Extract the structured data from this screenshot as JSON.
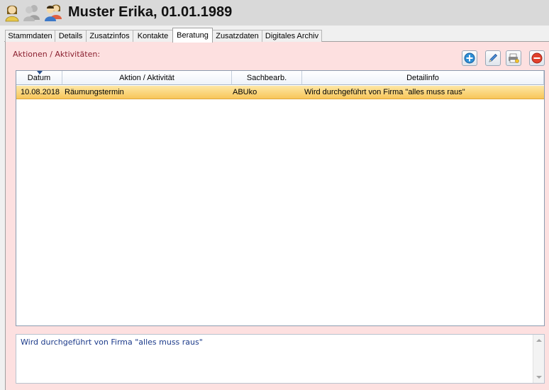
{
  "header": {
    "title": "Muster Erika, 01.01.1989",
    "icons": [
      "person-female-icon",
      "persons-gray-icon",
      "persons-color-icon"
    ]
  },
  "tabs": [
    {
      "label": "Stammdaten",
      "active": false
    },
    {
      "label": "Details",
      "active": false
    },
    {
      "label": "Zusatzinfos",
      "active": false
    },
    {
      "label": "Kontakte",
      "active": false
    },
    {
      "label": "Beratung",
      "active": true
    },
    {
      "label": "Zusatzdaten",
      "active": false
    },
    {
      "label": "Digitales Archiv",
      "active": false
    }
  ],
  "section": {
    "label": "Aktionen / Aktivitäten:"
  },
  "toolbar": {
    "buttons": [
      "add-icon",
      "edit-icon",
      "print-icon",
      "delete-icon"
    ]
  },
  "grid": {
    "columns": [
      "Datum",
      "Aktion / Aktivität",
      "Sachbearb.",
      "Detailinfo"
    ],
    "sort_column": "Datum",
    "rows": [
      [
        "10.08.2018",
        "Räumungstermin",
        "ABUko",
        "Wird durchgeführt von Firma \"alles muss raus\""
      ]
    ]
  },
  "detail": {
    "text": "Wird durchgeführt von Firma \"alles muss raus\""
  },
  "colors": {
    "panel_bg": "#fde0e0",
    "selected_row": "#f8c65a",
    "section_label": "#8b2030",
    "detail_text": "#1b3a8a"
  }
}
